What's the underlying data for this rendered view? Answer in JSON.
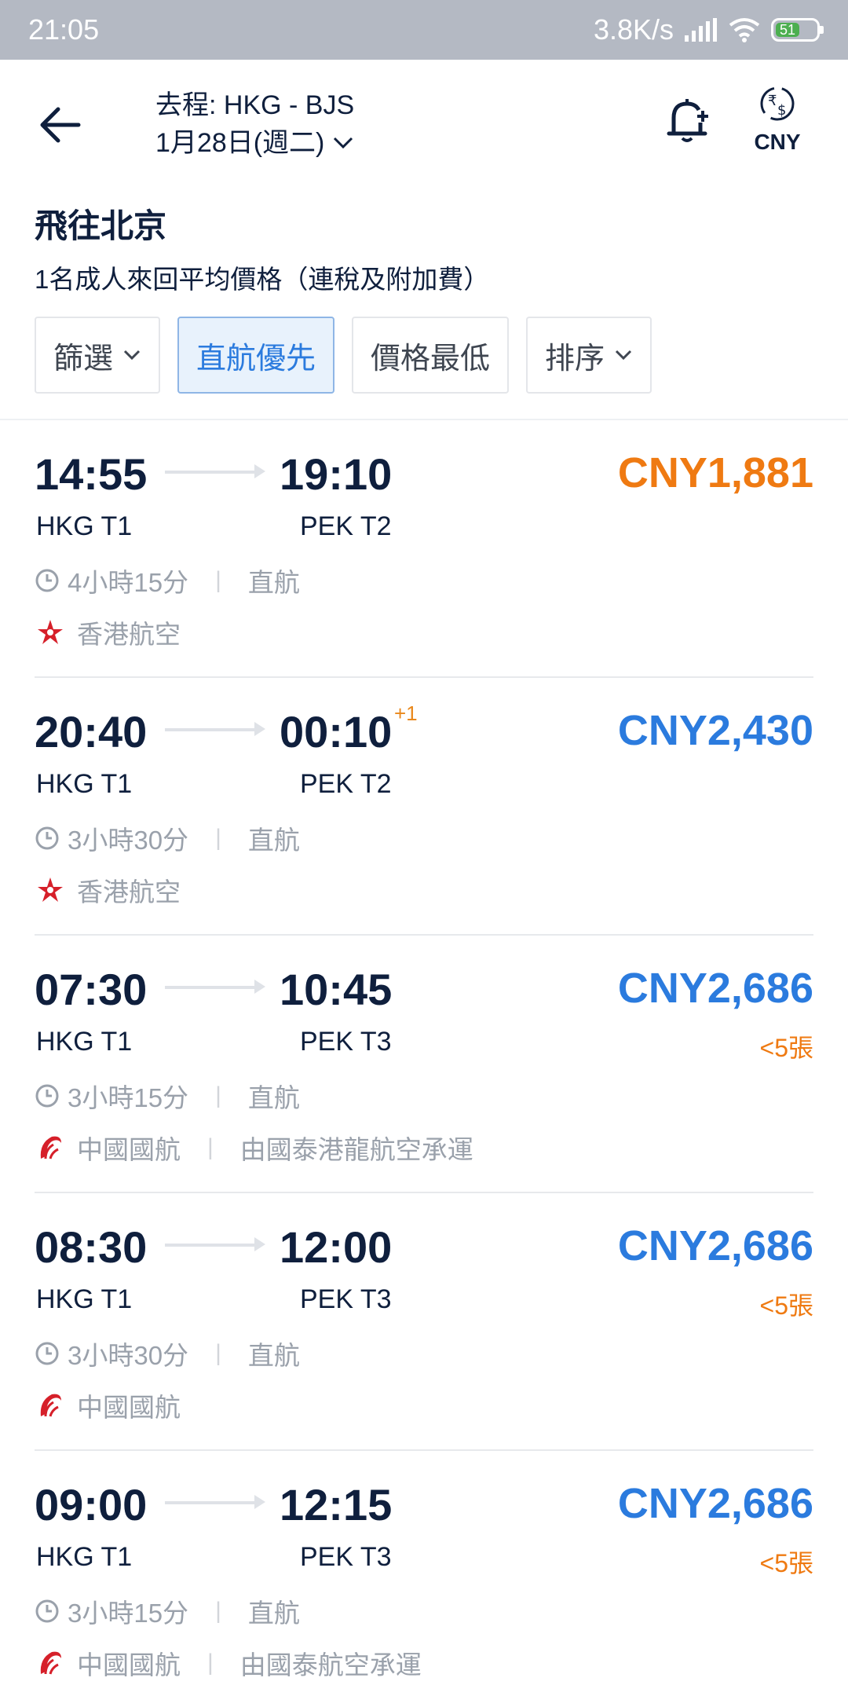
{
  "status_bar": {
    "time": "21:05",
    "network_speed": "3.8K/s",
    "battery": "51"
  },
  "header": {
    "route": "去程: HKG - BJS",
    "date": "1月28日(週二)",
    "currency_label": "CNY"
  },
  "title": "飛往北京",
  "subtitle": "1名成人來回平均價格（連稅及附加費）",
  "filters": [
    {
      "label": "篩選",
      "has_dropdown": true,
      "active": false
    },
    {
      "label": "直航優先",
      "has_dropdown": false,
      "active": true
    },
    {
      "label": "價格最低",
      "has_dropdown": false,
      "active": false
    },
    {
      "label": "排序",
      "has_dropdown": true,
      "active": false
    }
  ],
  "flights": [
    {
      "dep_time": "14:55",
      "arr_time": "19:10",
      "plus_day": "",
      "dep_terminal": "HKG T1",
      "arr_terminal": "PEK T2",
      "price": "CNY1,881",
      "price_highlight": true,
      "seats": "",
      "duration": "4小時15分",
      "stop_type": "直航",
      "airline": "香港航空",
      "operated_by": "",
      "airline_logo": "hong-kong-airlines-logo"
    },
    {
      "dep_time": "20:40",
      "arr_time": "00:10",
      "plus_day": "+1",
      "dep_terminal": "HKG T1",
      "arr_terminal": "PEK T2",
      "price": "CNY2,430",
      "price_highlight": false,
      "seats": "",
      "duration": "3小時30分",
      "stop_type": "直航",
      "airline": "香港航空",
      "operated_by": "",
      "airline_logo": "hong-kong-airlines-logo"
    },
    {
      "dep_time": "07:30",
      "arr_time": "10:45",
      "plus_day": "",
      "dep_terminal": "HKG T1",
      "arr_terminal": "PEK T3",
      "price": "CNY2,686",
      "price_highlight": false,
      "seats": "<5張",
      "duration": "3小時15分",
      "stop_type": "直航",
      "airline": "中國國航",
      "operated_by": "由國泰港龍航空承運",
      "airline_logo": "air-china-logo"
    },
    {
      "dep_time": "08:30",
      "arr_time": "12:00",
      "plus_day": "",
      "dep_terminal": "HKG T1",
      "arr_terminal": "PEK T3",
      "price": "CNY2,686",
      "price_highlight": false,
      "seats": "<5張",
      "duration": "3小時30分",
      "stop_type": "直航",
      "airline": "中國國航",
      "operated_by": "",
      "airline_logo": "air-china-logo"
    },
    {
      "dep_time": "09:00",
      "arr_time": "12:15",
      "plus_day": "",
      "dep_terminal": "HKG T1",
      "arr_terminal": "PEK T3",
      "price": "CNY2,686",
      "price_highlight": false,
      "seats": "<5張",
      "duration": "3小時15分",
      "stop_type": "直航",
      "airline": "中國國航",
      "operated_by": "由國泰航空承運",
      "airline_logo": "air-china-logo"
    }
  ],
  "colors": {
    "price_blue": "#2b7bde",
    "price_orange": "#ef7a12",
    "text_dark": "#0f1f3d",
    "muted": "#9aa1ab"
  }
}
